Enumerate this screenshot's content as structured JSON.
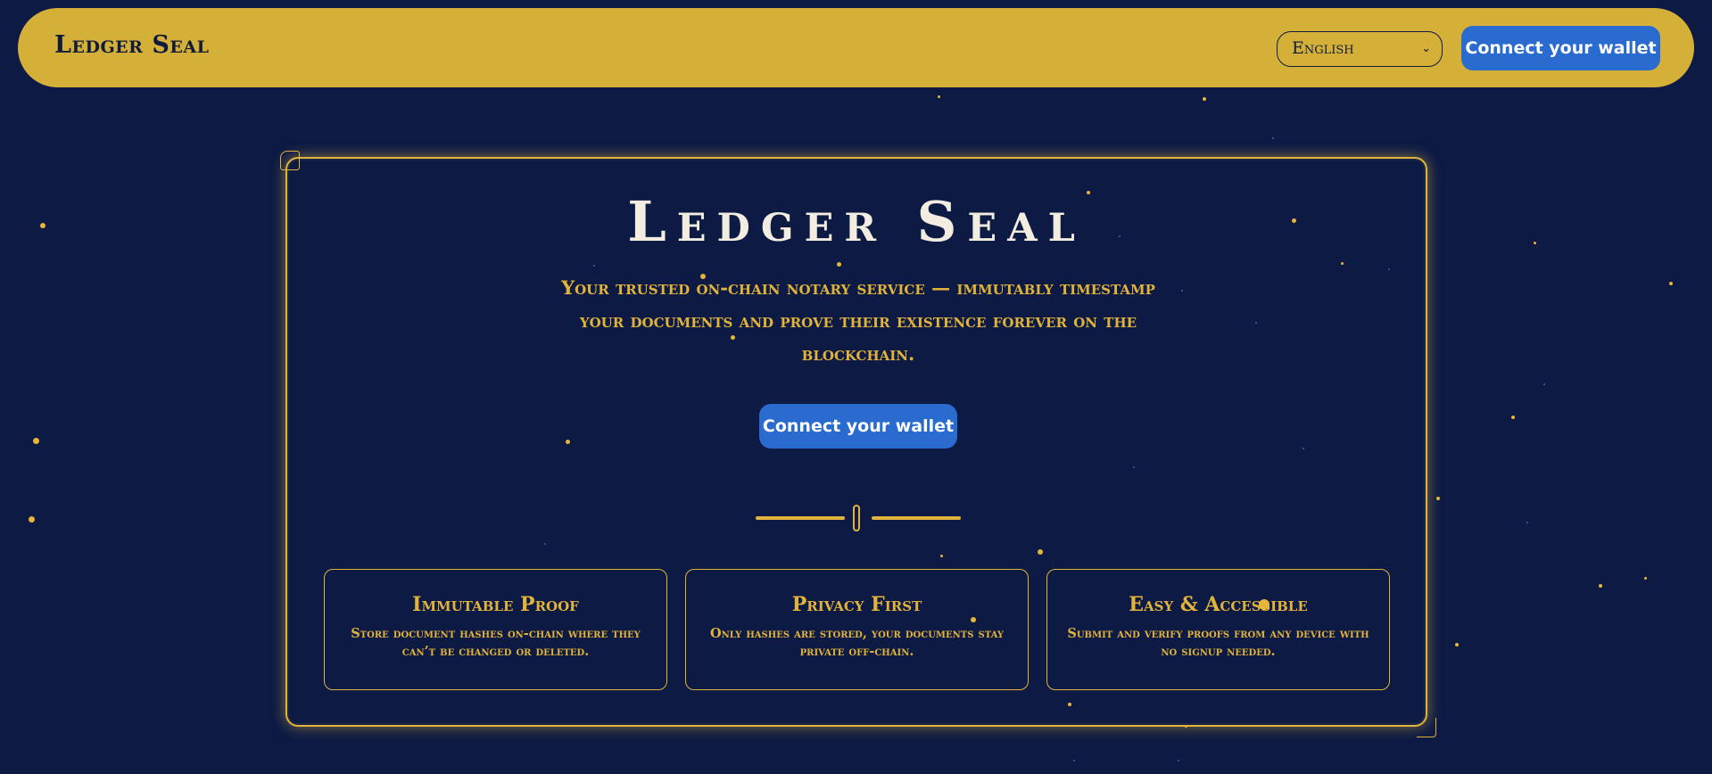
{
  "header": {
    "brand": "Ledger Seal",
    "language": {
      "selected": "English",
      "chevron": "⌄"
    },
    "connect_label": "Connect your wallet"
  },
  "hero": {
    "title": "Ledger Seal",
    "tagline": "Your trusted on-chain notary service — immutably timestamp your documents and prove their existence forever on the blockchain.",
    "connect_label": "Connect your wallet"
  },
  "features": [
    {
      "title": "Immutable Proof",
      "text": "Store document hashes on-chain where they can’t be changed or deleted."
    },
    {
      "title": "Privacy First",
      "text": "Only hashes are stored, your documents stay private off-chain."
    },
    {
      "title": "Easy & Accessible",
      "text": "Submit and verify proofs from any device with no signup needed."
    }
  ],
  "colors": {
    "background": "#0c1a44",
    "gold": "#d4b039",
    "accent_blue": "#2a6bd0",
    "title_text": "#f2ede0"
  }
}
